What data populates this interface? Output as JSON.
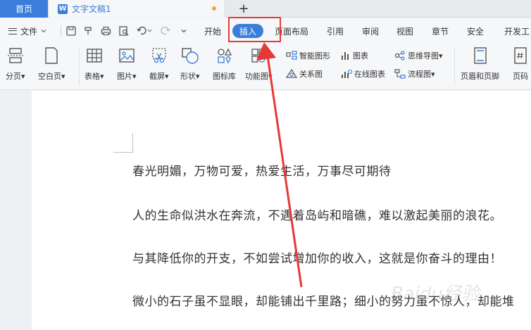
{
  "tabs": {
    "home": "首页",
    "doc": "文字文稿1",
    "doc_icon": "W",
    "add": "+"
  },
  "menu": {
    "file": "文件",
    "items": [
      "开始",
      "插入",
      "页面布局",
      "引用",
      "审阅",
      "视图",
      "章节",
      "安全",
      "开发工"
    ]
  },
  "ribbon": {
    "page_break": "分页",
    "blank_page": "空白页",
    "table": "表格",
    "picture": "图片",
    "screenshot": "截屏",
    "shape": "形状",
    "icon_lib": "图标库",
    "function": "功能图",
    "smart_graphic": "智能图形",
    "chart": "图表",
    "mind_map": "思维导图",
    "relation_graph": "关系图",
    "online_chart": "在线图表",
    "flowchart": "流程图",
    "header_footer": "页眉和页脚",
    "page_number": "页码"
  },
  "document": {
    "paragraphs": [
      "春光明媚，万物可爱，热爱生活，万事尽可期待",
      "人的生命似洪水在奔流，不遇着岛屿和暗礁，难以激起美丽的浪花。",
      "与其降低你的开支，不如尝试增加你的收入，这就是你奋斗的理由！",
      "微小的石子虽不显眼，却能铺出千里路；细小的努力虽不惊人，却能堆"
    ]
  },
  "watermark": "Baidu经验",
  "colors": {
    "accent": "#3b7ed9",
    "annotation": "#e53935",
    "unsaved_dot": "#f0a24a"
  }
}
